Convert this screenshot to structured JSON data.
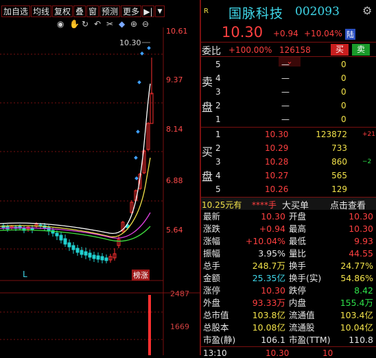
{
  "toolbar": {
    "buttons": [
      "加自选",
      "均线",
      "复权",
      "叠",
      "窗",
      "预测",
      "更多"
    ],
    "tool_icons": [
      "eye-icon",
      "hand-icon",
      "refresh-icon",
      "undo-icon",
      "scissors-icon",
      "diamond-icon",
      "plus-circle-icon",
      "minus-circle-icon"
    ]
  },
  "chart": {
    "price_axis": [
      "10.61",
      "9.37",
      "8.14",
      "6.88",
      "5.64"
    ],
    "current_price_tag": "10.30",
    "bottom_label": "L",
    "limit_badge": "榜涨",
    "volume_axis": [
      "2487",
      "1669"
    ],
    "colors": {
      "up": "#ff3030",
      "down": "#20d0d0",
      "ma5": "#ffffff",
      "ma10": "#f2e24a",
      "ma20": "#e040e0",
      "ma60": "#40e040"
    }
  },
  "header": {
    "badge": "R",
    "name": "国脉科技",
    "code": "002093",
    "price": "10.30",
    "change": "+0.94",
    "change_pct": "+10.04%",
    "exchange_tag": "陆"
  },
  "committee": {
    "label": "委比",
    "ratio": "+100.00%",
    "diff": "126158",
    "buy_btn": "买",
    "sell_btn": "卖"
  },
  "sell_side": {
    "label_top": "卖",
    "label_bottom": "盘",
    "rows": [
      {
        "level": "5",
        "price": "—",
        "vol": "0"
      },
      {
        "level": "4",
        "price": "—",
        "vol": "0"
      },
      {
        "level": "3",
        "price": "—",
        "vol": "0"
      },
      {
        "level": "2",
        "price": "—",
        "vol": "0"
      },
      {
        "level": "1",
        "price": "—",
        "vol": "0"
      }
    ]
  },
  "buy_side": {
    "label_top": "买",
    "label_bottom": "盘",
    "rows": [
      {
        "level": "1",
        "price": "10.30",
        "vol": "123872",
        "delta": "+21"
      },
      {
        "level": "2",
        "price": "10.29",
        "vol": "733",
        "delta": ""
      },
      {
        "level": "3",
        "price": "10.28",
        "vol": "860",
        "delta": "−2"
      },
      {
        "level": "4",
        "price": "10.27",
        "vol": "565",
        "delta": ""
      },
      {
        "level": "5",
        "price": "10.26",
        "vol": "129",
        "delta": ""
      }
    ]
  },
  "order_bar": {
    "price": "10.25元有",
    "qty": "****手",
    "big_buy": "大买单",
    "link": "点击查看"
  },
  "quotes": [
    {
      "l1": "最新",
      "v1": "10.30",
      "c1": "red",
      "l2": "开盘",
      "v2": "10.30",
      "c2": "red"
    },
    {
      "l1": "涨跌",
      "v1": "+0.94",
      "c1": "red",
      "l2": "最高",
      "v2": "10.30",
      "c2": "red"
    },
    {
      "l1": "涨幅",
      "v1": "+10.04%",
      "c1": "red",
      "l2": "最低",
      "v2": "9.93",
      "c2": "red"
    },
    {
      "l1": "振幅",
      "v1": "3.95%",
      "c1": "white",
      "l2": "量比",
      "v2": "44.55",
      "c2": "red"
    },
    {
      "l1": "总手",
      "v1": "248.7万",
      "c1": "yellow",
      "l2": "换手",
      "v2": "24.77%",
      "c2": "yellow"
    },
    {
      "l1": "金额",
      "v1": "25.35亿",
      "c1": "cyan",
      "l2": "换手(实)",
      "v2": "54.86%",
      "c2": "yellow"
    },
    {
      "l1": "涨停",
      "v1": "10.30",
      "c1": "red",
      "l2": "跌停",
      "v2": "8.42",
      "c2": "green"
    },
    {
      "l1": "外盘",
      "v1": "93.33万",
      "c1": "red",
      "l2": "内盘",
      "v2": "155.4万",
      "c2": "green"
    },
    {
      "l1": "总市值",
      "v1": "103.8亿",
      "c1": "yellow",
      "l2": "流通值",
      "v2": "103.4亿",
      "c2": "yellow"
    },
    {
      "l1": "总股本",
      "v1": "10.08亿",
      "c1": "yellow",
      "l2": "流通股",
      "v2": "10.04亿",
      "c2": "yellow"
    },
    {
      "l1": "市盈(静)",
      "v1": "106.1",
      "c1": "white",
      "l2": "市盈(TTM)",
      "v2": "110.8",
      "c2": "white"
    }
  ],
  "tick_partial": {
    "time": "13:10",
    "price": "10.30",
    "vol": "10"
  }
}
